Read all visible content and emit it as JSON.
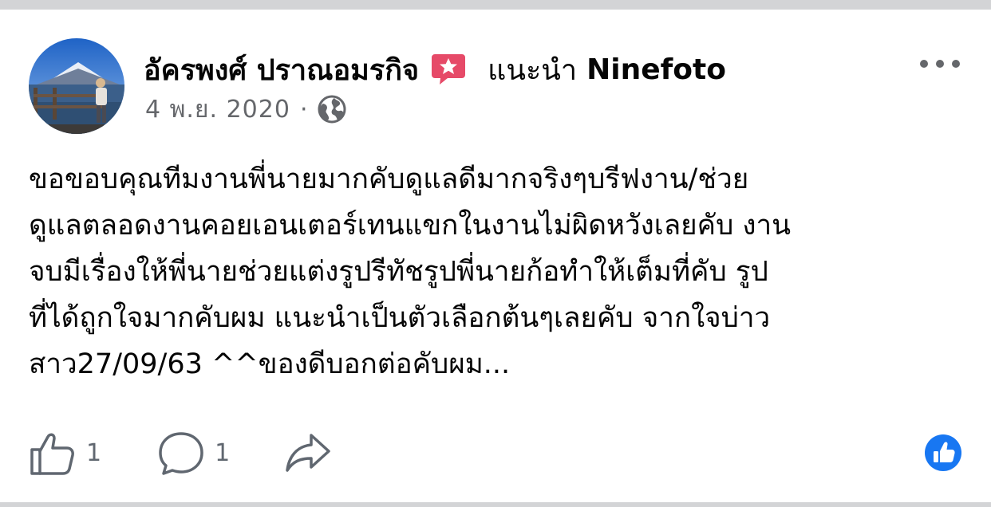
{
  "post": {
    "author_name": "อัครพงศ์ ปราณอมรกิจ",
    "recommend_text": "แนะนำ",
    "recommend_page": "Ninefoto",
    "date": "4 พ.ย. 2020",
    "separator": "·",
    "privacy_icon": "globe-icon",
    "recommend_icon": "recommend-star-icon",
    "body_lines": [
      "ขอขอบคุณทีมงานพี่นายมากคับดูแลดีมากจริงๆบรีฟงาน/ช่วย",
      "ดูแลตลอดงานคอยเอนเตอร์เทนแขกในงานไม่ผิดหวังเลยคับ งาน",
      "จบมีเรื่องให้พี่นายช่วยแต่งรูปรีทัชรูปพี่นายก้อทำให้เต็มที่คับ รูป",
      "ที่ได้ถูกใจมากคับผม แนะนำเป็นตัวเลือกต้นๆเลยคับ จากใจบ่าว",
      "สาว27/09/63 ^^ของดีบอกต่อคับผม..."
    ]
  },
  "actions": {
    "like_count": "1",
    "comment_count": "1",
    "like_icon": "thumbs-up-icon",
    "comment_icon": "comment-bubble-icon",
    "share_icon": "share-arrow-icon"
  },
  "colors": {
    "text": "#050505",
    "secondary": "#65676b",
    "accent_blue": "#1877f2",
    "recommend_red": "#e64a68",
    "separator_gray": "#d3d4d6"
  }
}
